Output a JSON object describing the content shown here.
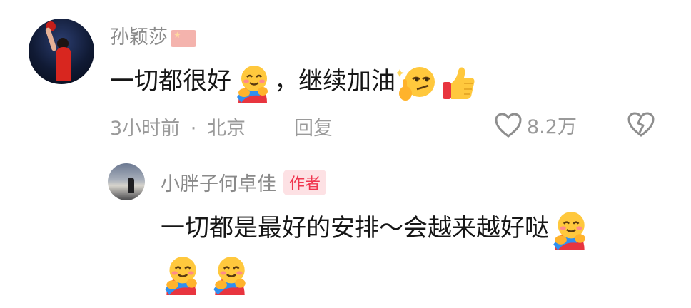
{
  "comment": {
    "username": "孙颖莎",
    "user_badge_icon": "china-flag-icon",
    "text_part1": "一切都很好",
    "text_part2": "，继续加油",
    "emojis": [
      "hug-emoji-icon",
      "smirk-emoji-icon",
      "thumbs-up-icon"
    ],
    "time": "3小时前",
    "separator": "·",
    "location": "北京",
    "reply_label": "回复",
    "like_count": "8.2万",
    "like_icon": "heart-outline-icon",
    "dislike_icon": "broken-heart-icon"
  },
  "reply": {
    "username": "小胖子何卓佳",
    "author_tag": "作者",
    "text": "一切都是最好的安排～会越来越好哒",
    "emojis": [
      "hug-emoji-icon",
      "hug-emoji-icon",
      "hug-emoji-icon"
    ]
  },
  "colors": {
    "username": "#8a8a8a",
    "text": "#161616",
    "meta": "#9a9a9a",
    "author_tag_bg": "#fde1e4",
    "author_tag_text": "#f0364f"
  }
}
